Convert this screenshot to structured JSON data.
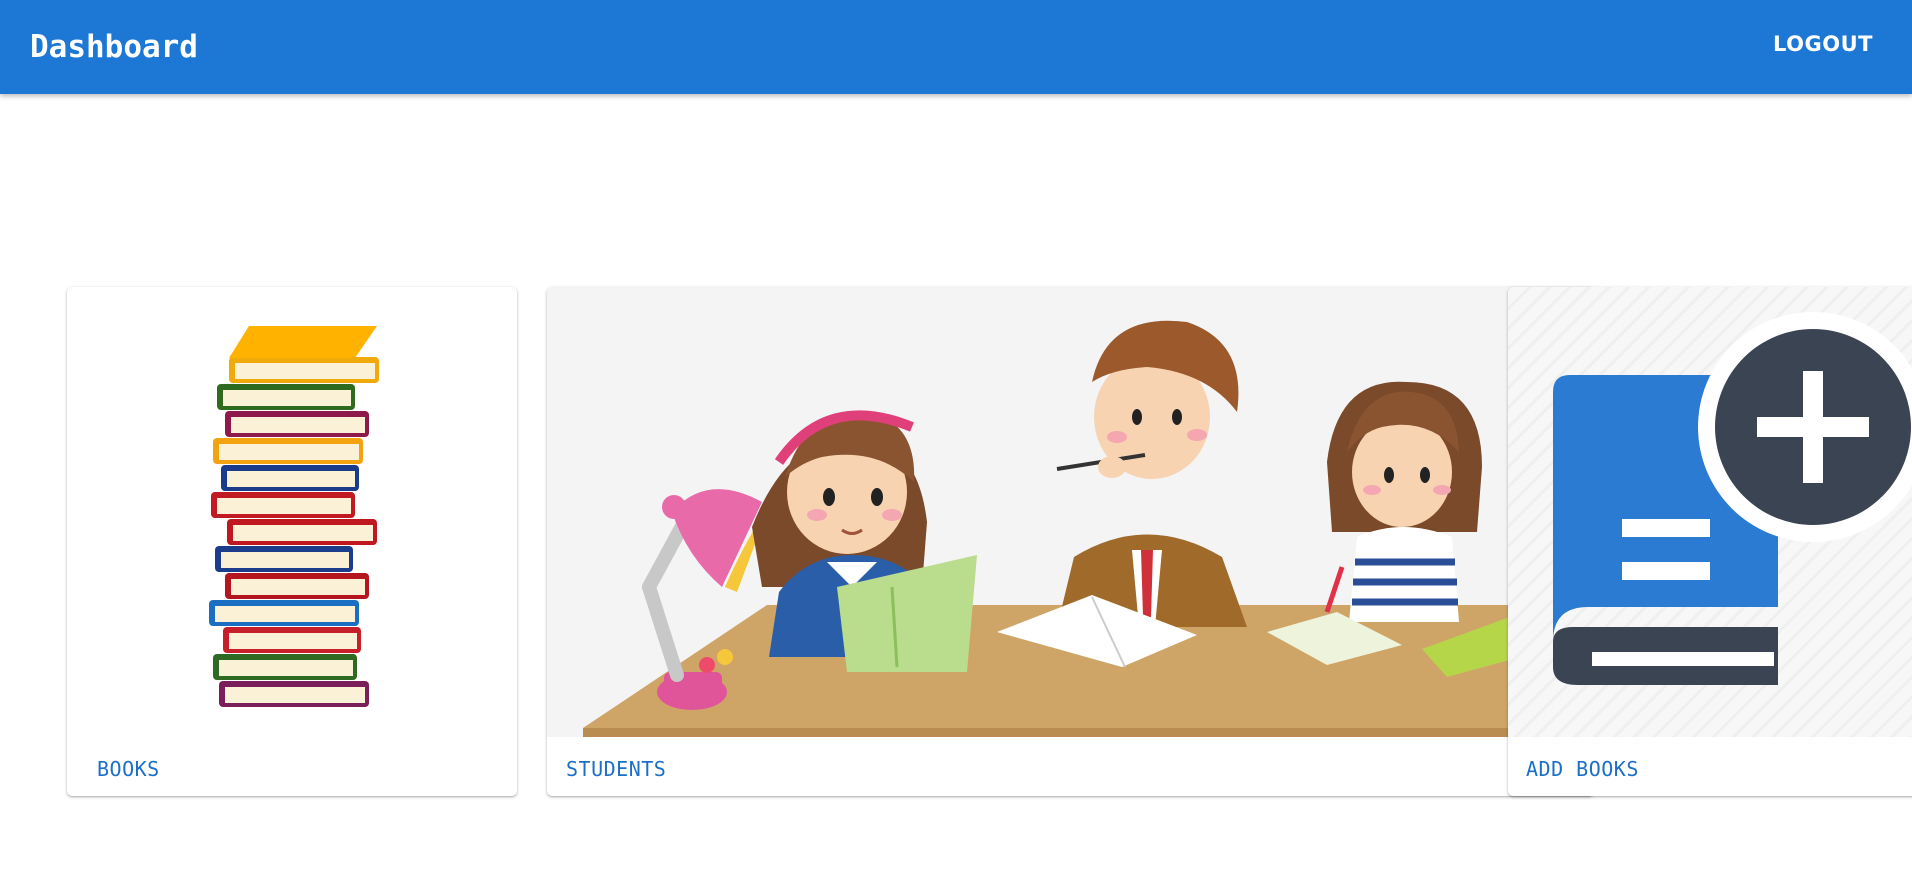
{
  "app": {
    "title": "Dashboard",
    "logout_label": "LOGOUT"
  },
  "colors": {
    "appbar": "#1c78d4",
    "action_text": "#1c6fc8",
    "background": "#ffffff"
  },
  "cards": [
    {
      "id": "books",
      "action_label": "BOOKS",
      "image": "stack-of-books-illustration"
    },
    {
      "id": "students",
      "action_label": "STUDENTS",
      "image": "children-studying-at-desk-illustration"
    },
    {
      "id": "add_books",
      "action_label": "ADD BOOKS",
      "image": "book-with-plus-icon"
    }
  ]
}
